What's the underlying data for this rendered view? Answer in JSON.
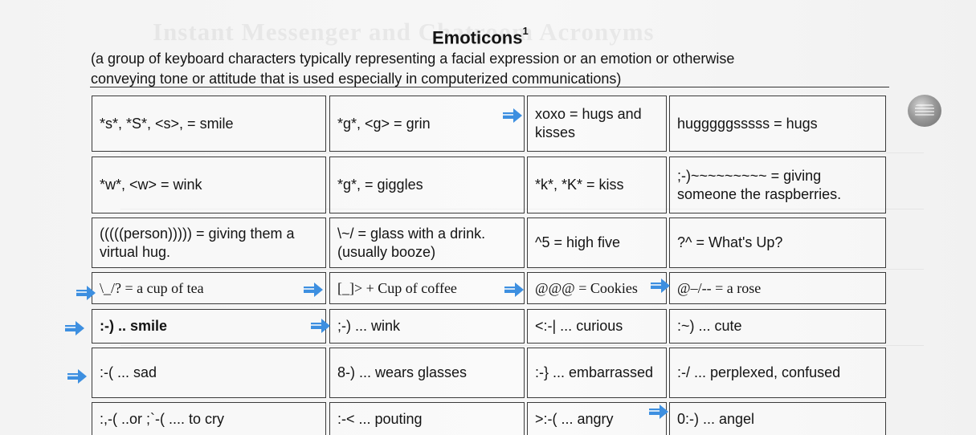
{
  "document": {
    "ghost_heading": "Instant Messenger and Chatroom Acronyms",
    "title": "Emoticons",
    "title_footnote": "1",
    "intro_line1": "(a group of keyboard characters typically representing a facial expression or an emotion or otherwise",
    "intro_line2": "conveying tone or attitude that is used especially in computerized communications)"
  },
  "rows": [
    [
      "*s*, *S*, <s>, = smile",
      "*g*, <g> = grin",
      "xoxo = hugs and kisses",
      "hugggggsssss = hugs"
    ],
    [
      "*w*, <w> = wink",
      "*g*, = giggles",
      "*k*, *K* = kiss",
      ";-)~~~~~~~~~ = giving someone the raspberries."
    ],
    [
      "(((((person))))) = giving them a virtual hug.",
      "\\~/ = glass with a drink. (usually booze)",
      "^5 = high five",
      "?^ = What's Up?"
    ],
    [
      "\\_/? = a cup of tea",
      "[_]> + Cup of coffee",
      "@@@ = Cookies",
      "@–/-- = a rose"
    ],
    [
      ":-) .. smile",
      ";-) ... wink",
      "<:-| ... curious",
      ":~) ... cute"
    ],
    [
      ":-( ... sad",
      "8-) ... wears glasses",
      ":-} ... embarrassed",
      ":-/ ... perplexed, confused"
    ],
    [
      ":,-( ..or ;`-( .... to cry",
      ":-< ... pouting",
      ">:-( ... angry",
      "0:-) ... angel"
    ]
  ],
  "colors": {
    "arrow": "#3d8fe0",
    "border": "#3a3a3a",
    "text": "#141414"
  },
  "icons": {
    "marker": "right-arrow-icon",
    "side_button": "scroll-button-icon"
  }
}
